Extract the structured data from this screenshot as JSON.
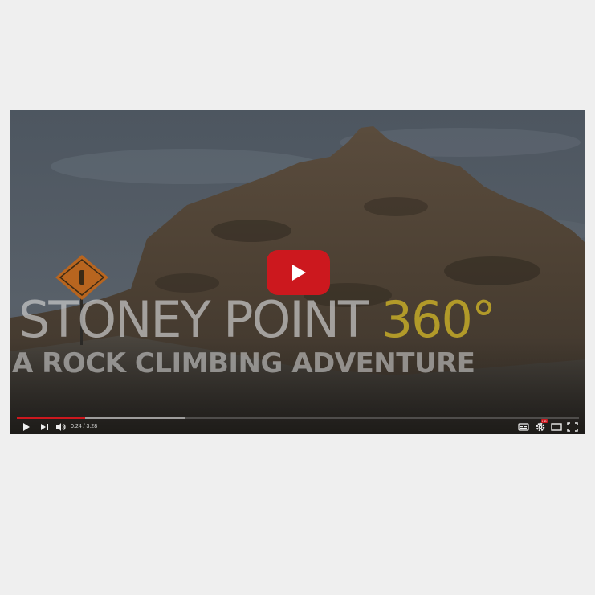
{
  "video": {
    "title_line1_main": "STONEY POINT",
    "title_line1_accent": "360°",
    "title_line2": "A ROCK CLIMBING ADVENTURE",
    "current_time": "0:24",
    "time_separator": " / ",
    "duration": "3:28",
    "played_fraction": 0.122,
    "loaded_fraction": 0.3
  },
  "controls": {
    "play_icon": "play-icon",
    "next_icon": "next-icon",
    "volume_icon": "volume-icon",
    "captions_icon": "captions-icon",
    "settings_icon": "gear-icon",
    "settings_badge": "HD",
    "theater_icon": "theater-mode-icon",
    "fullscreen_icon": "fullscreen-icon"
  },
  "colors": {
    "play_button": "#cc181e",
    "progress_played": "#cc181e",
    "title_accent": "#c4aa28",
    "page_background": "#efefef"
  }
}
